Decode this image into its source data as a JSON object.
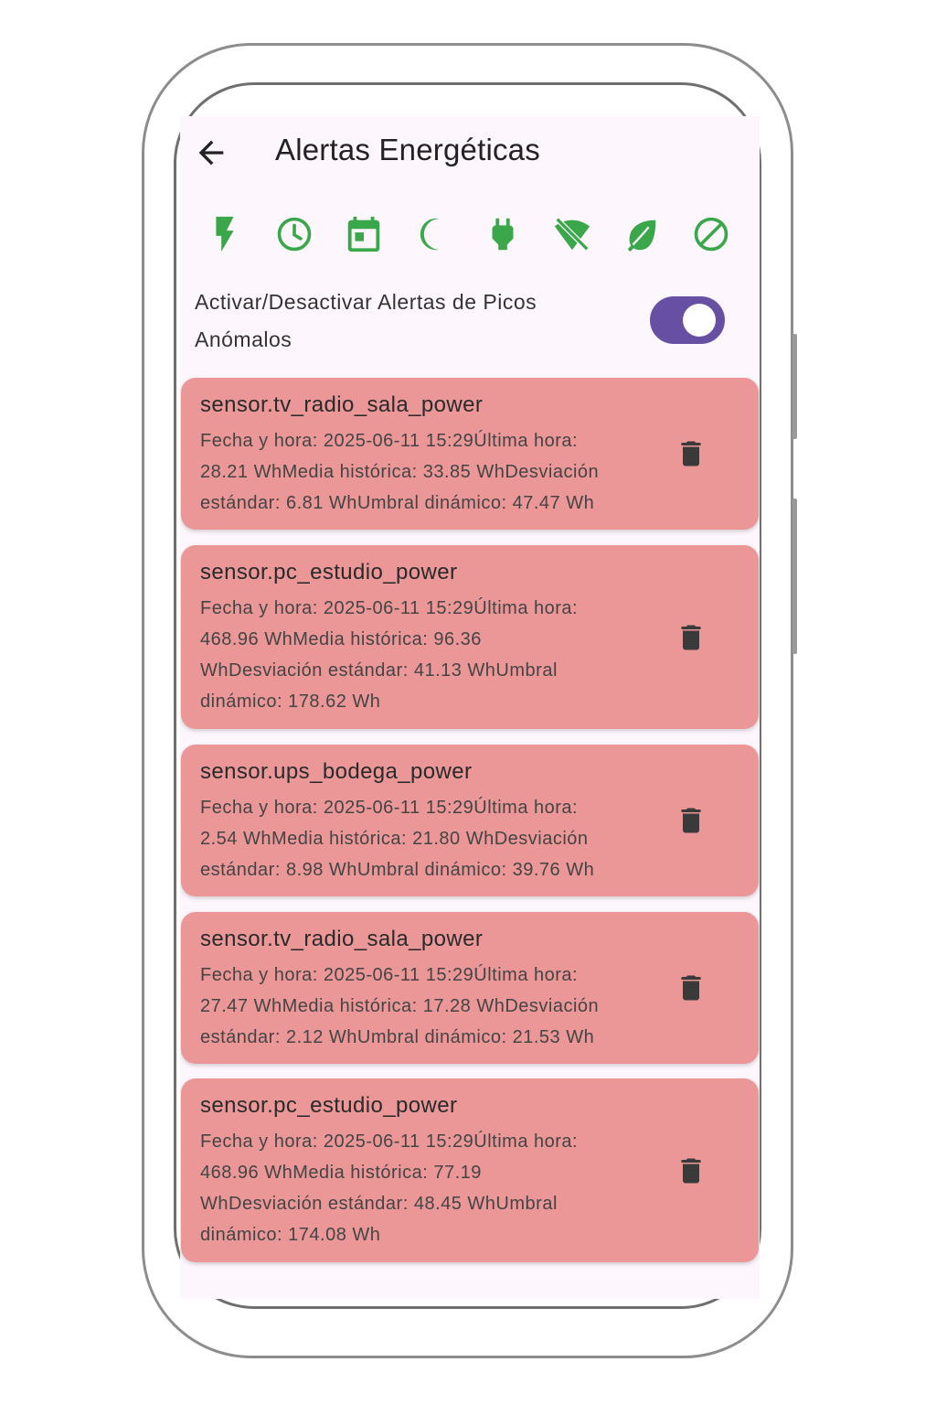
{
  "header": {
    "title": "Alertas Energéticas"
  },
  "filter_icons": [
    {
      "name": "lightning-bolt-icon"
    },
    {
      "name": "clock-icon"
    },
    {
      "name": "calendar-icon"
    },
    {
      "name": "moon-icon"
    },
    {
      "name": "plug-icon"
    },
    {
      "name": "wifi-off-icon"
    },
    {
      "name": "leaf-icon"
    },
    {
      "name": "block-icon"
    }
  ],
  "toggle": {
    "label_line1": "Activar/Desactivar Alertas de Picos",
    "label_line2": "Anómalos",
    "on": true
  },
  "colors": {
    "accent": "#6750a4",
    "icon_green": "#3aa84a",
    "card_bg": "#eb9798",
    "screen_bg": "#fdf7fd"
  },
  "alerts": [
    {
      "sensor": "sensor.tv_radio_sala_power",
      "lines": [
        "Fecha y hora: 2025-06-11 15:29Última hora:",
        "28.21 WhMedia histórica: 33.85 WhDesviación",
        "estándar: 6.81 WhUmbral dinámico: 47.47 Wh"
      ]
    },
    {
      "sensor": "sensor.pc_estudio_power",
      "lines": [
        "Fecha y hora: 2025-06-11 15:29Última hora:",
        "468.96 WhMedia histórica: 96.36",
        "WhDesviación estándar: 41.13 WhUmbral",
        "dinámico: 178.62 Wh"
      ]
    },
    {
      "sensor": "sensor.ups_bodega_power",
      "lines": [
        "Fecha y hora: 2025-06-11 15:29Última hora:",
        "2.54 WhMedia histórica: 21.80 WhDesviación",
        "estándar: 8.98 WhUmbral dinámico: 39.76 Wh"
      ]
    },
    {
      "sensor": "sensor.tv_radio_sala_power",
      "lines": [
        "Fecha y hora: 2025-06-11 15:29Última hora:",
        "27.47 WhMedia histórica: 17.28 WhDesviación",
        "estándar: 2.12 WhUmbral dinámico: 21.53 Wh"
      ]
    },
    {
      "sensor": "sensor.pc_estudio_power",
      "lines": [
        "Fecha y hora: 2025-06-11 15:29Última hora:",
        "468.96 WhMedia histórica: 77.19",
        "WhDesviación estándar: 48.45 WhUmbral",
        "dinámico: 174.08 Wh"
      ]
    }
  ]
}
